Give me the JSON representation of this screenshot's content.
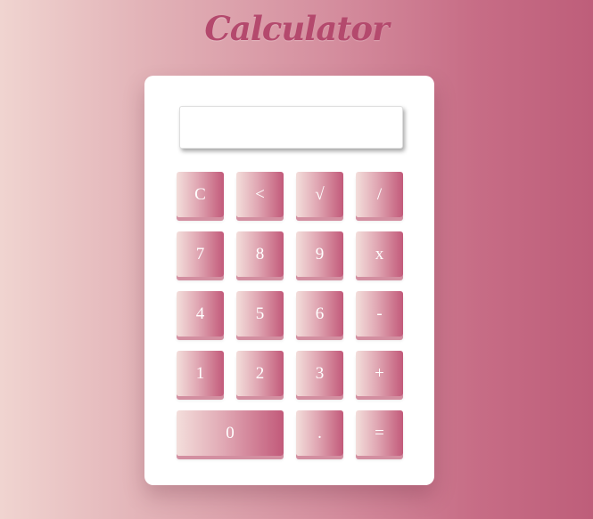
{
  "title": "Calculator",
  "display": {
    "value": ""
  },
  "keys": {
    "clear": "C",
    "back": "<",
    "sqrt": "√",
    "divide": "/",
    "seven": "7",
    "eight": "8",
    "nine": "9",
    "multiply": "x",
    "four": "4",
    "five": "5",
    "six": "6",
    "minus": "-",
    "one": "1",
    "two": "2",
    "three": "3",
    "plus": "+",
    "zero": "0",
    "decimal": ".",
    "equals": "="
  },
  "colors": {
    "title": "#b4496d",
    "key_gradient_start": "#f3dedb",
    "key_gradient_end": "#c25a7a",
    "key_shadow": "#d38fa1",
    "panel": "#ffffff"
  }
}
